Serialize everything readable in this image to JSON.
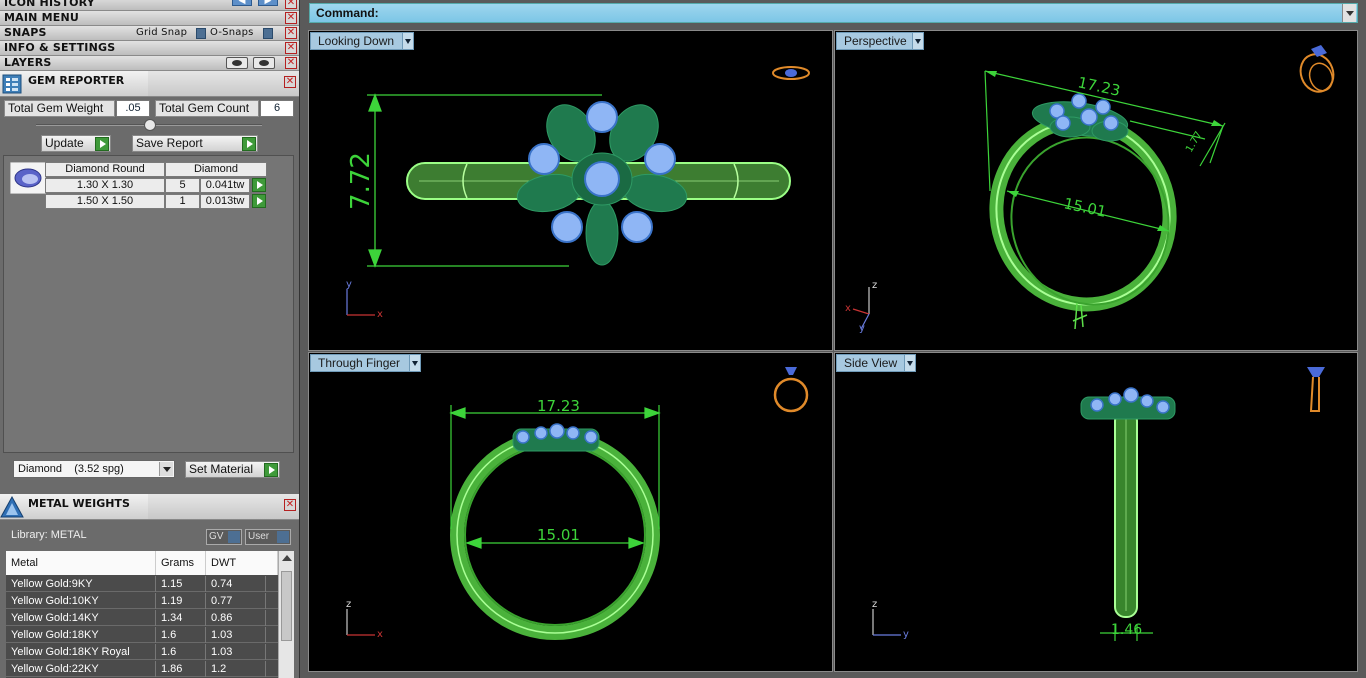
{
  "left_panel": {
    "icon_history": "ICON HISTORY",
    "main_menu": "MAIN MENU",
    "snaps": "SNAPS",
    "grid_snap": "Grid Snap",
    "o_snaps": "O-Snaps",
    "info_settings": "INFO & SETTINGS",
    "layers": "LAYERS",
    "close_glyph": "✕"
  },
  "gem_reporter": {
    "title": "GEM REPORTER",
    "total_weight_label": "Total Gem Weight",
    "total_weight_value": ".05",
    "total_count_label": "Total Gem Count",
    "total_count_value": "6",
    "update_label": "Update",
    "save_report_label": "Save Report",
    "columns": [
      "Diamond Round",
      "Diamond"
    ],
    "rows": [
      {
        "size": "1.30 X 1.30",
        "count": "5",
        "weight": "0.041tw"
      },
      {
        "size": "1.50 X 1.50",
        "count": "1",
        "weight": "0.013tw"
      }
    ],
    "material_select": "Diamond    (3.52 spg)",
    "set_material_label": "Set Material"
  },
  "metal_weights": {
    "title": "METAL WEIGHTS",
    "library_label": "Library: METAL",
    "gv_label": "GV",
    "user_label": "User",
    "columns": [
      "Metal",
      "Grams",
      "DWT"
    ],
    "rows": [
      {
        "metal": "Yellow Gold:9KY",
        "grams": "1.15",
        "dwt": "0.74"
      },
      {
        "metal": "Yellow Gold:10KY",
        "grams": "1.19",
        "dwt": "0.77"
      },
      {
        "metal": "Yellow Gold:14KY",
        "grams": "1.34",
        "dwt": "0.86"
      },
      {
        "metal": "Yellow Gold:18KY",
        "grams": "1.6",
        "dwt": "1.03"
      },
      {
        "metal": "Yellow Gold:18KY Royal",
        "grams": "1.6",
        "dwt": "1.03"
      },
      {
        "metal": "Yellow Gold:22KY",
        "grams": "1.86",
        "dwt": "1.2"
      }
    ]
  },
  "command": {
    "label": "Command:"
  },
  "viewports": {
    "top_left": {
      "title": "Looking Down",
      "dimension": "7.72",
      "axis_a": "y",
      "axis_b": "x"
    },
    "top_right": {
      "title": "Perspective",
      "dim_a": "17.23",
      "dim_b": "15.01",
      "dim_c": "1.77",
      "axis_a": "z",
      "axis_b": "x",
      "axis_c": "y"
    },
    "bottom_left": {
      "title": "Through Finger",
      "dim_a": "17.23",
      "dim_b": "15.01",
      "axis_a": "z",
      "axis_b": "x"
    },
    "bottom_right": {
      "title": "Side View",
      "dim_a": "1.46",
      "axis_a": "z",
      "axis_b": "y"
    }
  },
  "colors": {
    "ring_green": "#5dde4a",
    "dim_green": "#3dd43a",
    "leaf_green": "#1f7a4e",
    "gem_blue": "#8fb6f5",
    "icon_gold": "#e08a2a",
    "command_blue": "#8fd0ec"
  }
}
